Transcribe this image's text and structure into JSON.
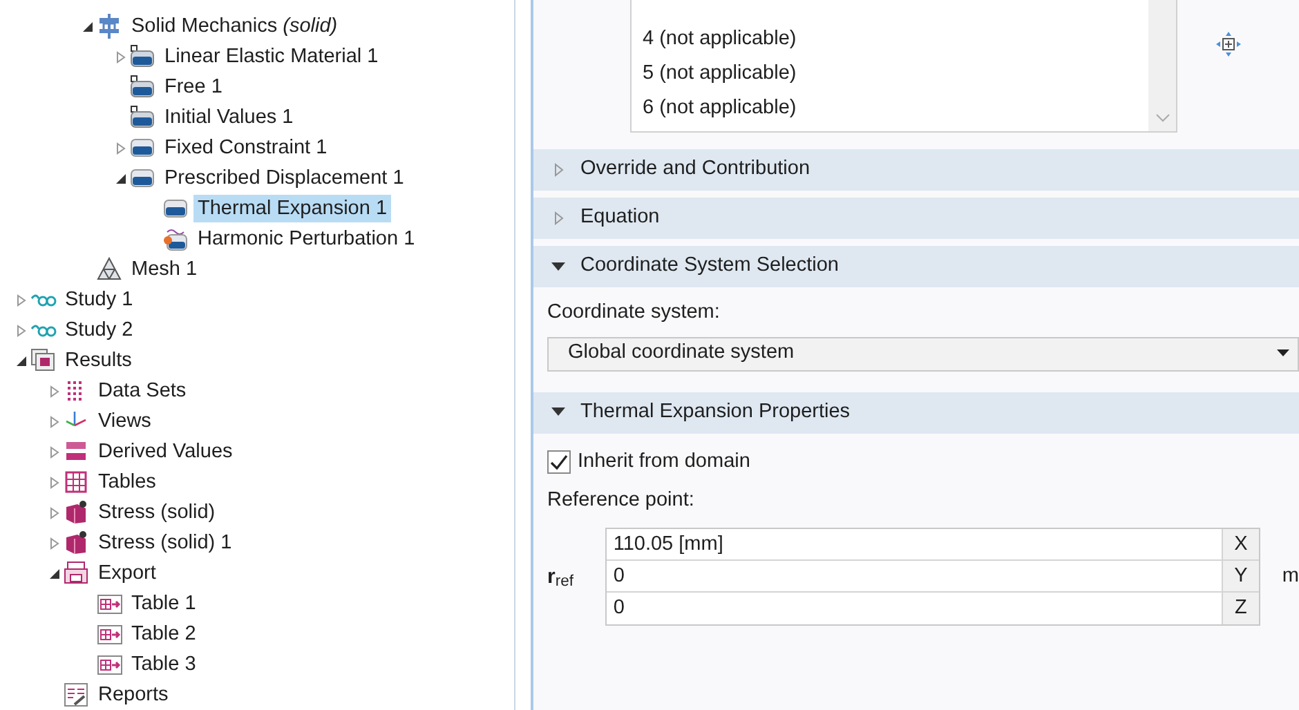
{
  "tree": {
    "partial_branch": [
      {
        "label": "Solid Mechanics",
        "tag": "*(solid)*",
        "kind": "physics",
        "expanded": true,
        "selected": false,
        "children": [
          {
            "label": "Linear Elastic Material 1",
            "kind": "default-feature",
            "expanded": false,
            "selected": false
          },
          {
            "label": "Free 1",
            "kind": "default-feature",
            "selected": false
          },
          {
            "label": "Initial Values 1",
            "kind": "default-feature",
            "selected": false
          },
          {
            "label": "Fixed Constraint 1",
            "kind": "feature",
            "expanded": false,
            "selected": false
          },
          {
            "label": "Prescribed Displacement 1",
            "kind": "feature",
            "expanded": true,
            "selected": false,
            "children": [
              {
                "label": "Thermal Expansion 1",
                "kind": "feature",
                "selected": true
              },
              {
                "label": "Harmonic Perturbation 1",
                "kind": "perturbation",
                "selected": false
              }
            ]
          }
        ]
      },
      {
        "label": "Mesh 1",
        "kind": "mesh",
        "selected": false
      }
    ],
    "items": [
      {
        "label": "Study 1",
        "kind": "study",
        "expanded": false,
        "selected": false
      },
      {
        "label": "Study 2",
        "kind": "study",
        "expanded": false,
        "selected": false
      },
      {
        "label": "Results",
        "kind": "results",
        "expanded": true,
        "selected": false,
        "children": [
          {
            "label": "Data Sets",
            "kind": "datasets",
            "expanded": false,
            "selected": false
          },
          {
            "label": "Views",
            "kind": "views",
            "expanded": false,
            "selected": false
          },
          {
            "label": "Derived Values",
            "kind": "derived",
            "expanded": false,
            "selected": false
          },
          {
            "label": "Tables",
            "kind": "tables",
            "expanded": false,
            "selected": false
          },
          {
            "label": "Stress (solid)",
            "kind": "stress",
            "expanded": false,
            "selected": false
          },
          {
            "label": "Stress (solid) 1",
            "kind": "stress",
            "expanded": false,
            "selected": false
          },
          {
            "label": "Export",
            "kind": "export",
            "expanded": true,
            "selected": false,
            "children": [
              {
                "label": "Table 1",
                "kind": "export-table",
                "selected": false
              },
              {
                "label": "Table 2",
                "kind": "export-table",
                "selected": false
              },
              {
                "label": "Table 3",
                "kind": "export-table",
                "selected": false
              }
            ]
          },
          {
            "label": "Reports",
            "kind": "reports",
            "selected": false
          }
        ]
      }
    ]
  },
  "selection_list": {
    "items": [
      "4 (not applicable)",
      "5 (not applicable)",
      "6 (not applicable)"
    ]
  },
  "sections": [
    {
      "title": "Override and Contribution",
      "expanded": false
    },
    {
      "title": "Equation",
      "expanded": false
    },
    {
      "title": "Coordinate System Selection",
      "expanded": true,
      "content": {
        "kind": "coordinate",
        "label": "Coordinate system:",
        "value": "Global coordinate system"
      }
    },
    {
      "title": "Thermal Expansion Properties",
      "expanded": true,
      "content": {
        "kind": "thermal",
        "checkbox": {
          "label": "Inherit from domain",
          "checked": true
        },
        "label": "Reference point:",
        "symbol": "**r**$_{ref}$",
        "unit": "m",
        "rows": [
          {
            "value": "110.05 [mm]",
            "axis": "X"
          },
          {
            "value": "0",
            "axis": "Y"
          },
          {
            "value": "0",
            "axis": "Z"
          }
        ]
      }
    }
  ]
}
